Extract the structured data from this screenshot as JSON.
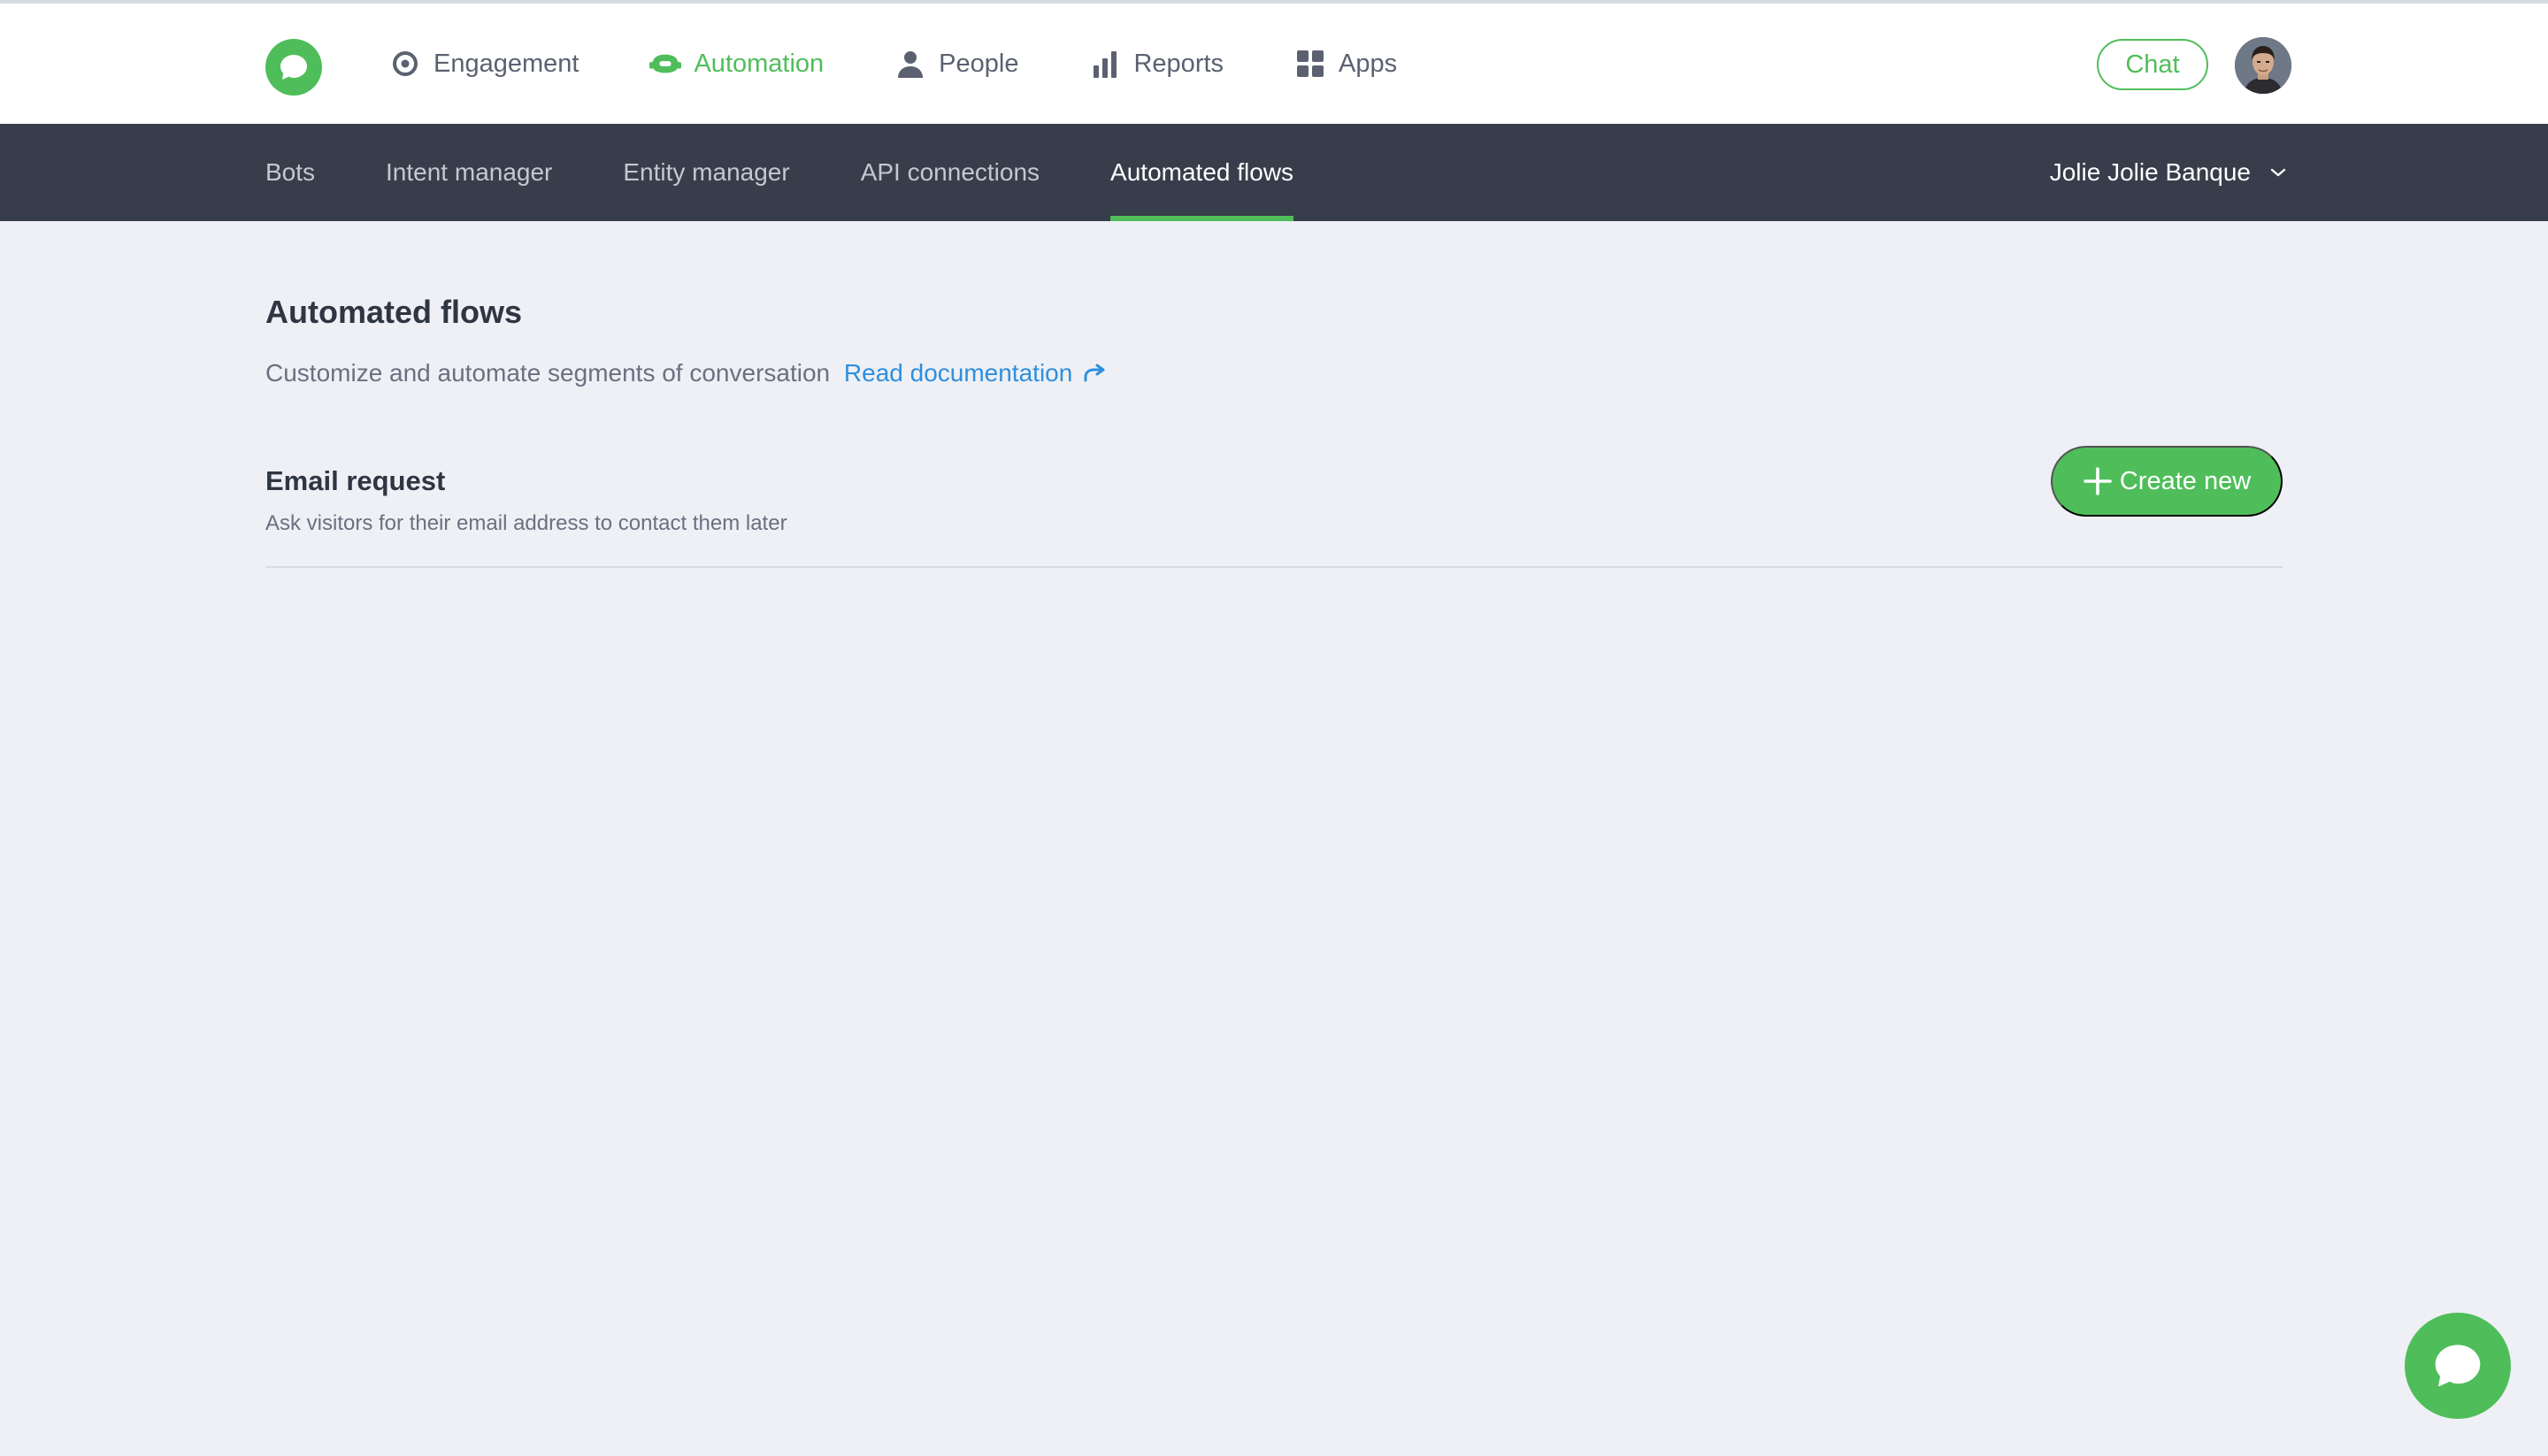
{
  "topnav": {
    "items": [
      {
        "label": "Engagement",
        "icon": "target-icon"
      },
      {
        "label": "Automation",
        "icon": "robot-icon"
      },
      {
        "label": "People",
        "icon": "person-icon"
      },
      {
        "label": "Reports",
        "icon": "bar-chart-icon"
      },
      {
        "label": "Apps",
        "icon": "grid-icon"
      }
    ],
    "active_index": 1,
    "chat_label": "Chat"
  },
  "subnav": {
    "tabs": [
      {
        "label": "Bots"
      },
      {
        "label": "Intent manager"
      },
      {
        "label": "Entity manager"
      },
      {
        "label": "API connections"
      },
      {
        "label": "Automated flows"
      }
    ],
    "active_index": 4,
    "account_name": "Jolie Jolie Banque"
  },
  "main": {
    "title": "Automated flows",
    "description": "Customize and automate segments of conversation",
    "doc_link_label": "Read documentation",
    "flows": [
      {
        "title": "Email request",
        "description": "Ask visitors for their email address to contact them later",
        "create_label": "Create new"
      }
    ]
  },
  "colors": {
    "accent": "#4fbe5a",
    "subnav_bg": "#373d4a",
    "page_bg": "#eef0f5",
    "link": "#2f8fde"
  }
}
